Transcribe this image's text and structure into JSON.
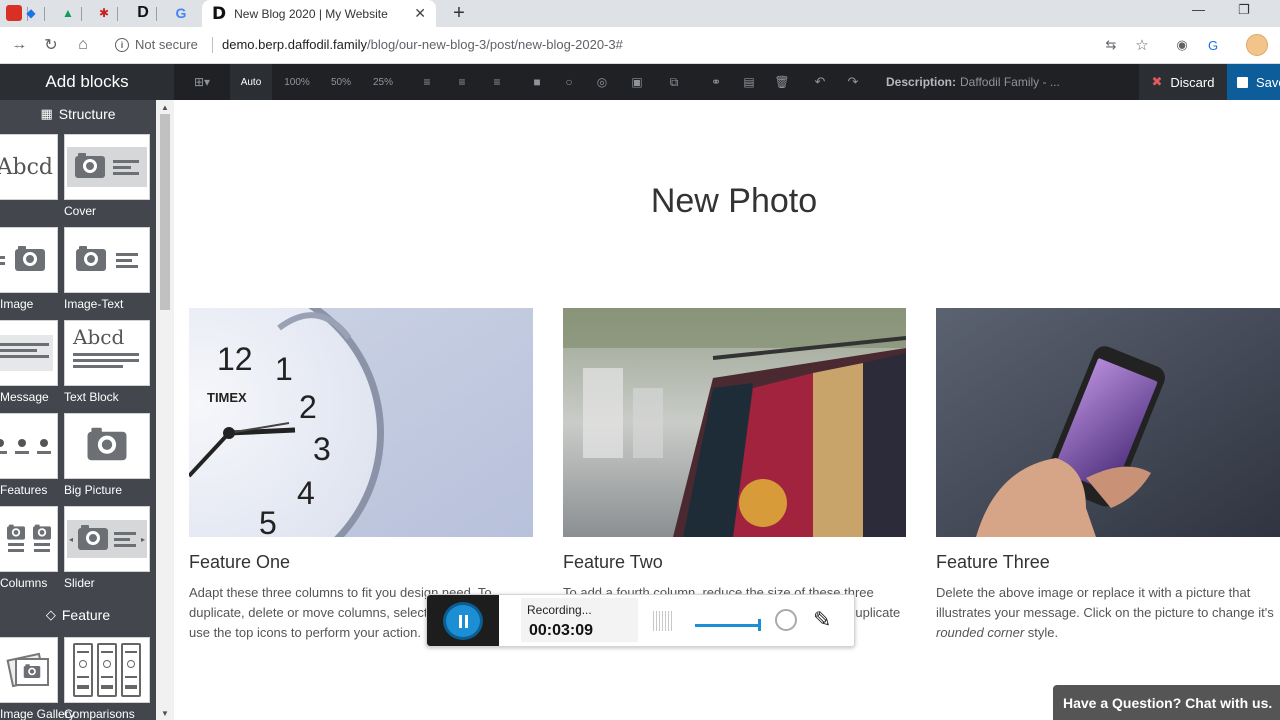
{
  "browser": {
    "pinned_tabs": [
      {
        "icon": "red-tab-icon",
        "glyph": "",
        "color": "#d93025"
      },
      {
        "icon": "blue-shield-icon",
        "glyph": "◆",
        "color": "#1a73e8"
      },
      {
        "icon": "google-drive-icon",
        "glyph": "▲",
        "color": "#0f9d58"
      },
      {
        "icon": "red-logo-icon",
        "glyph": "✱",
        "color": "#c5221f"
      },
      {
        "icon": "d-logo-icon",
        "glyph": "D",
        "color": "#111111"
      },
      {
        "icon": "google-icon",
        "glyph": "G",
        "color": "#4285f4"
      }
    ],
    "active_tab": {
      "favicon": "D",
      "title": "New Blog 2020 | My Website",
      "close": "✕"
    },
    "new_tab": "+",
    "window_controls": {
      "minimize": "—",
      "restore": "❐"
    },
    "address": {
      "security_text": "Not secure",
      "url_host": "demo.berp.daffodil.family",
      "url_path": "/blog/our-new-blog-3/post/new-blog-2020-3#"
    }
  },
  "editor": {
    "sidebar_title": "Add blocks",
    "toolbar": {
      "sizes": [
        "Auto",
        "100%",
        "50%",
        "25%"
      ],
      "description_label": "Description:",
      "description_value": "Daffodil Family - ...",
      "discard_label": "Discard",
      "save_label": "Save"
    },
    "sections": [
      {
        "label": "Structure",
        "icon": "grid-icon"
      },
      {
        "label": "Feature",
        "icon": "diamond-icon"
      }
    ],
    "blocks": [
      {
        "label": "",
        "thumb_text": "Abcd"
      },
      {
        "label": "Cover"
      },
      {
        "label": "Image"
      },
      {
        "label": "Image-Text"
      },
      {
        "label": "Message"
      },
      {
        "label": "Text Block",
        "thumb_text": "Abcd"
      },
      {
        "label": "Features"
      },
      {
        "label": "Big Picture"
      },
      {
        "label": "Columns"
      },
      {
        "label": "Slider"
      },
      {
        "label": "Image Gallery"
      },
      {
        "label": "Comparisons"
      }
    ]
  },
  "page": {
    "title": "New Photo",
    "features": [
      {
        "title": "Feature One",
        "desc": "Adapt these three columns to fit you design need. To duplicate, delete or move columns, select the column and use the top icons to perform your action."
      },
      {
        "title": "Feature Two",
        "desc": "To add a fourth column, reduce the size of these three columns using the right icon of each block. Then, duplicate one of the column to create a new one as a copy."
      },
      {
        "title": "Feature Three",
        "desc_before": "Delete the above image or replace it with a picture that illustrates your message. Click on the picture to change it's ",
        "desc_em": "rounded corner",
        "desc_after": " style."
      }
    ]
  },
  "recorder": {
    "status": "Recording...",
    "time": "00:03:09"
  },
  "chat": {
    "label": "Have a Question? Chat with us."
  }
}
